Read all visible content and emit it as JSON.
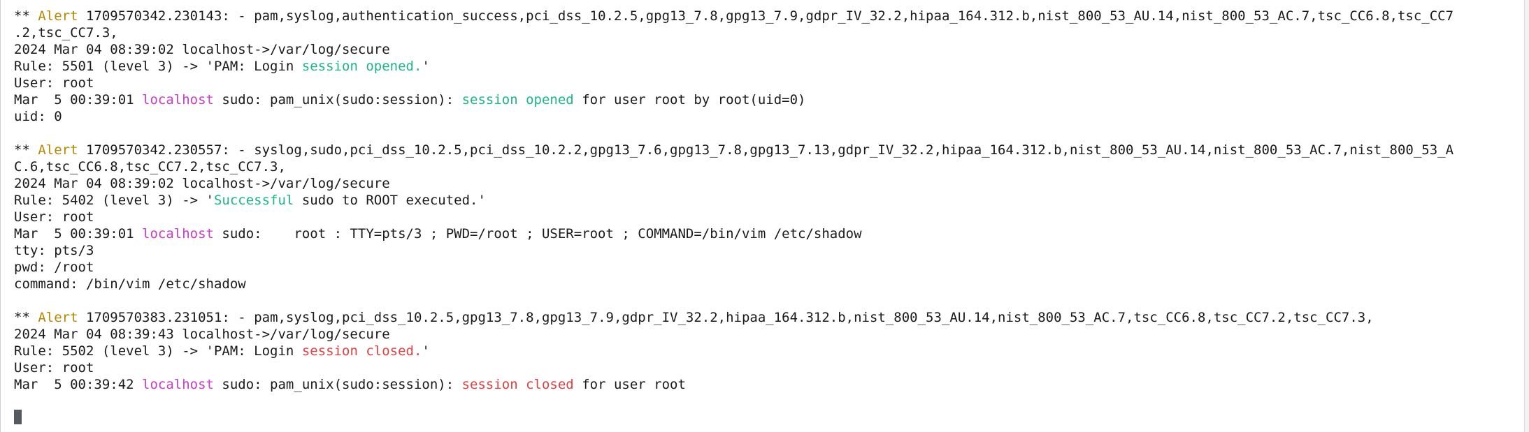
{
  "alerts": [
    {
      "prefix": "** ",
      "label": "Alert",
      "header_rest": " 1709570342.230143: - pam,syslog,authentication_success,pci_dss_10.2.5,gpg13_7.8,gpg13_7.9,gdpr_IV_32.2,hipaa_164.312.b,nist_800_53_AU.14,nist_800_53_AC.7,tsc_CC6.8,tsc_CC7",
      "header_wrap": ".2,tsc_CC7.3,",
      "date_line": "2024 Mar 04 08:39:02 localhost->/var/log/secure",
      "rule_pre": "Rule: 5501 (level 3) -> 'PAM: Login ",
      "rule_hl": "session opened.",
      "rule_post": "'",
      "user_line": "User: root",
      "log_pre": "Mar  5 00:39:01 ",
      "log_host": "localhost",
      "log_mid": " sudo: pam_unix(sudo:session): ",
      "log_hl": "session opened",
      "log_post": " for user root by root(uid=0)",
      "extra": [
        "uid: 0"
      ]
    },
    {
      "prefix": "** ",
      "label": "Alert",
      "header_rest": " 1709570342.230557: - syslog,sudo,pci_dss_10.2.5,pci_dss_10.2.2,gpg13_7.6,gpg13_7.8,gpg13_7.13,gdpr_IV_32.2,hipaa_164.312.b,nist_800_53_AU.14,nist_800_53_AC.7,nist_800_53_A",
      "header_wrap": "C.6,tsc_CC6.8,tsc_CC7.2,tsc_CC7.3,",
      "date_line": "2024 Mar 04 08:39:02 localhost->/var/log/secure",
      "rule_pre": "Rule: 5402 (level 3) -> '",
      "rule_hl": "Successful",
      "rule_post": " sudo to ROOT executed.'",
      "user_line": "User: root",
      "log_pre": "Mar  5 00:39:01 ",
      "log_host": "localhost",
      "log_mid": " sudo:    root : TTY=pts/3 ; PWD=/root ; USER=root ; COMMAND=/bin/vim /etc/shadow",
      "log_hl": "",
      "log_post": "",
      "extra": [
        "tty: pts/3",
        "pwd: /root",
        "command: /bin/vim /etc/shadow"
      ]
    },
    {
      "prefix": "** ",
      "label": "Alert",
      "header_rest": " 1709570383.231051: - pam,syslog,pci_dss_10.2.5,gpg13_7.8,gpg13_7.9,gdpr_IV_32.2,hipaa_164.312.b,nist_800_53_AU.14,nist_800_53_AC.7,tsc_CC6.8,tsc_CC7.2,tsc_CC7.3,",
      "header_wrap": "",
      "date_line": "2024 Mar 04 08:39:43 localhost->/var/log/secure",
      "rule_pre": "Rule: 5502 (level 3) -> 'PAM: Login ",
      "rule_hl": "session closed.",
      "rule_post": "'",
      "user_line": "User: root",
      "log_pre": "Mar  5 00:39:42 ",
      "log_host": "localhost",
      "log_mid": " sudo: pam_unix(sudo:session): ",
      "log_hl": "session closed",
      "log_post": " for user root",
      "extra": []
    }
  ],
  "colors": {
    "alert_label": "#b58900",
    "hostname": "#c73dc7",
    "success_text": "#1bb58a",
    "closed_text": "#e04040",
    "foreground": "#1a1a1a",
    "background": "#ffffff"
  }
}
